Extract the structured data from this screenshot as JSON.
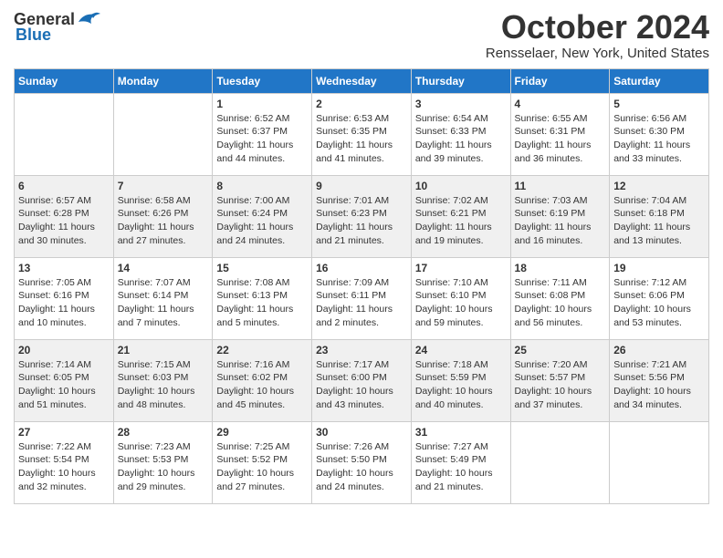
{
  "header": {
    "logo_general": "General",
    "logo_blue": "Blue",
    "month": "October 2024",
    "location": "Rensselaer, New York, United States"
  },
  "days_of_week": [
    "Sunday",
    "Monday",
    "Tuesday",
    "Wednesday",
    "Thursday",
    "Friday",
    "Saturday"
  ],
  "weeks": [
    [
      {
        "day": "",
        "sunrise": "",
        "sunset": "",
        "daylight": ""
      },
      {
        "day": "",
        "sunrise": "",
        "sunset": "",
        "daylight": ""
      },
      {
        "day": "1",
        "sunrise": "Sunrise: 6:52 AM",
        "sunset": "Sunset: 6:37 PM",
        "daylight": "Daylight: 11 hours and 44 minutes."
      },
      {
        "day": "2",
        "sunrise": "Sunrise: 6:53 AM",
        "sunset": "Sunset: 6:35 PM",
        "daylight": "Daylight: 11 hours and 41 minutes."
      },
      {
        "day": "3",
        "sunrise": "Sunrise: 6:54 AM",
        "sunset": "Sunset: 6:33 PM",
        "daylight": "Daylight: 11 hours and 39 minutes."
      },
      {
        "day": "4",
        "sunrise": "Sunrise: 6:55 AM",
        "sunset": "Sunset: 6:31 PM",
        "daylight": "Daylight: 11 hours and 36 minutes."
      },
      {
        "day": "5",
        "sunrise": "Sunrise: 6:56 AM",
        "sunset": "Sunset: 6:30 PM",
        "daylight": "Daylight: 11 hours and 33 minutes."
      }
    ],
    [
      {
        "day": "6",
        "sunrise": "Sunrise: 6:57 AM",
        "sunset": "Sunset: 6:28 PM",
        "daylight": "Daylight: 11 hours and 30 minutes."
      },
      {
        "day": "7",
        "sunrise": "Sunrise: 6:58 AM",
        "sunset": "Sunset: 6:26 PM",
        "daylight": "Daylight: 11 hours and 27 minutes."
      },
      {
        "day": "8",
        "sunrise": "Sunrise: 7:00 AM",
        "sunset": "Sunset: 6:24 PM",
        "daylight": "Daylight: 11 hours and 24 minutes."
      },
      {
        "day": "9",
        "sunrise": "Sunrise: 7:01 AM",
        "sunset": "Sunset: 6:23 PM",
        "daylight": "Daylight: 11 hours and 21 minutes."
      },
      {
        "day": "10",
        "sunrise": "Sunrise: 7:02 AM",
        "sunset": "Sunset: 6:21 PM",
        "daylight": "Daylight: 11 hours and 19 minutes."
      },
      {
        "day": "11",
        "sunrise": "Sunrise: 7:03 AM",
        "sunset": "Sunset: 6:19 PM",
        "daylight": "Daylight: 11 hours and 16 minutes."
      },
      {
        "day": "12",
        "sunrise": "Sunrise: 7:04 AM",
        "sunset": "Sunset: 6:18 PM",
        "daylight": "Daylight: 11 hours and 13 minutes."
      }
    ],
    [
      {
        "day": "13",
        "sunrise": "Sunrise: 7:05 AM",
        "sunset": "Sunset: 6:16 PM",
        "daylight": "Daylight: 11 hours and 10 minutes."
      },
      {
        "day": "14",
        "sunrise": "Sunrise: 7:07 AM",
        "sunset": "Sunset: 6:14 PM",
        "daylight": "Daylight: 11 hours and 7 minutes."
      },
      {
        "day": "15",
        "sunrise": "Sunrise: 7:08 AM",
        "sunset": "Sunset: 6:13 PM",
        "daylight": "Daylight: 11 hours and 5 minutes."
      },
      {
        "day": "16",
        "sunrise": "Sunrise: 7:09 AM",
        "sunset": "Sunset: 6:11 PM",
        "daylight": "Daylight: 11 hours and 2 minutes."
      },
      {
        "day": "17",
        "sunrise": "Sunrise: 7:10 AM",
        "sunset": "Sunset: 6:10 PM",
        "daylight": "Daylight: 10 hours and 59 minutes."
      },
      {
        "day": "18",
        "sunrise": "Sunrise: 7:11 AM",
        "sunset": "Sunset: 6:08 PM",
        "daylight": "Daylight: 10 hours and 56 minutes."
      },
      {
        "day": "19",
        "sunrise": "Sunrise: 7:12 AM",
        "sunset": "Sunset: 6:06 PM",
        "daylight": "Daylight: 10 hours and 53 minutes."
      }
    ],
    [
      {
        "day": "20",
        "sunrise": "Sunrise: 7:14 AM",
        "sunset": "Sunset: 6:05 PM",
        "daylight": "Daylight: 10 hours and 51 minutes."
      },
      {
        "day": "21",
        "sunrise": "Sunrise: 7:15 AM",
        "sunset": "Sunset: 6:03 PM",
        "daylight": "Daylight: 10 hours and 48 minutes."
      },
      {
        "day": "22",
        "sunrise": "Sunrise: 7:16 AM",
        "sunset": "Sunset: 6:02 PM",
        "daylight": "Daylight: 10 hours and 45 minutes."
      },
      {
        "day": "23",
        "sunrise": "Sunrise: 7:17 AM",
        "sunset": "Sunset: 6:00 PM",
        "daylight": "Daylight: 10 hours and 43 minutes."
      },
      {
        "day": "24",
        "sunrise": "Sunrise: 7:18 AM",
        "sunset": "Sunset: 5:59 PM",
        "daylight": "Daylight: 10 hours and 40 minutes."
      },
      {
        "day": "25",
        "sunrise": "Sunrise: 7:20 AM",
        "sunset": "Sunset: 5:57 PM",
        "daylight": "Daylight: 10 hours and 37 minutes."
      },
      {
        "day": "26",
        "sunrise": "Sunrise: 7:21 AM",
        "sunset": "Sunset: 5:56 PM",
        "daylight": "Daylight: 10 hours and 34 minutes."
      }
    ],
    [
      {
        "day": "27",
        "sunrise": "Sunrise: 7:22 AM",
        "sunset": "Sunset: 5:54 PM",
        "daylight": "Daylight: 10 hours and 32 minutes."
      },
      {
        "day": "28",
        "sunrise": "Sunrise: 7:23 AM",
        "sunset": "Sunset: 5:53 PM",
        "daylight": "Daylight: 10 hours and 29 minutes."
      },
      {
        "day": "29",
        "sunrise": "Sunrise: 7:25 AM",
        "sunset": "Sunset: 5:52 PM",
        "daylight": "Daylight: 10 hours and 27 minutes."
      },
      {
        "day": "30",
        "sunrise": "Sunrise: 7:26 AM",
        "sunset": "Sunset: 5:50 PM",
        "daylight": "Daylight: 10 hours and 24 minutes."
      },
      {
        "day": "31",
        "sunrise": "Sunrise: 7:27 AM",
        "sunset": "Sunset: 5:49 PM",
        "daylight": "Daylight: 10 hours and 21 minutes."
      },
      {
        "day": "",
        "sunrise": "",
        "sunset": "",
        "daylight": ""
      },
      {
        "day": "",
        "sunrise": "",
        "sunset": "",
        "daylight": ""
      }
    ]
  ]
}
